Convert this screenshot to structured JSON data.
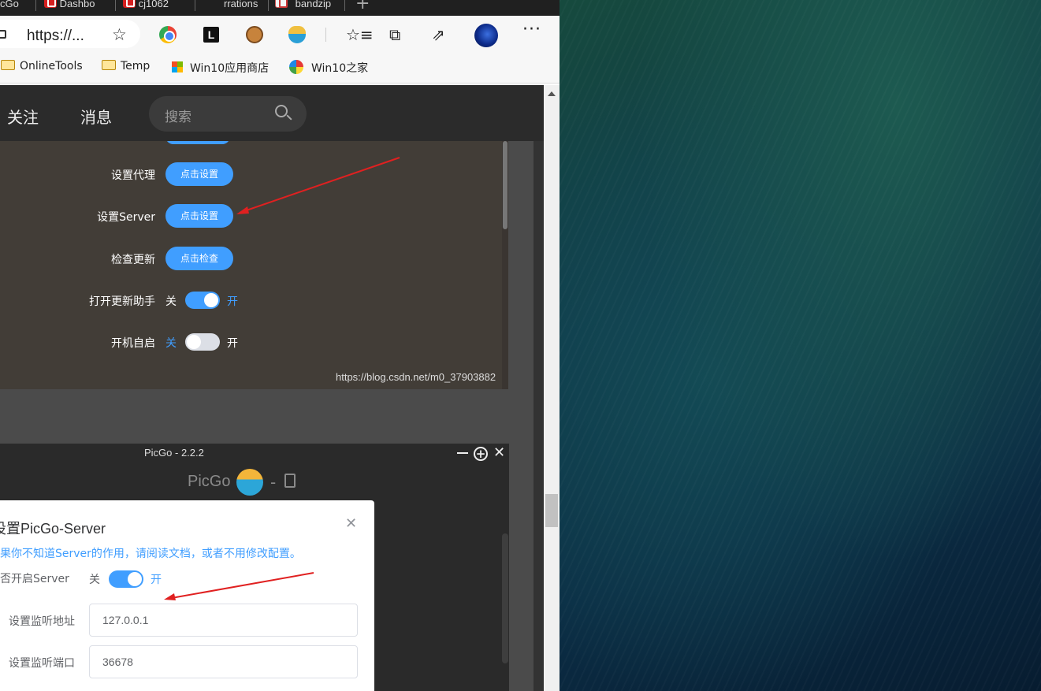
{
  "browser": {
    "tabs": [
      {
        "label": "cGo"
      },
      {
        "label": "Dashbo"
      },
      {
        "label": "cj1062"
      },
      {
        "label": "rrations"
      },
      {
        "label": "bandzip"
      }
    ],
    "url": "https://...",
    "bookmarks": [
      {
        "label": "OnlineTools"
      },
      {
        "label": "Temp"
      },
      {
        "label": "Win10应用商店"
      },
      {
        "label": "Win10之家"
      }
    ]
  },
  "site": {
    "nav": {
      "follow": "关注",
      "messages": "消息"
    },
    "search": {
      "placeholder": "搜索"
    }
  },
  "settings_panel": {
    "proxy": {
      "label": "设置代理",
      "button": "点击设置"
    },
    "server": {
      "label": "设置Server",
      "button": "点击设置"
    },
    "update": {
      "label": "检查更新",
      "button": "点击检查"
    },
    "update_helper": {
      "label": "打开更新助手",
      "off": "关",
      "on": "开",
      "enabled": true
    },
    "autostart": {
      "label": "开机自启",
      "off": "关",
      "on": "开",
      "enabled": false
    },
    "watermark": "https://blog.csdn.net/m0_37903882"
  },
  "picgo_window": {
    "title": "PicGo - 2.2.2",
    "brand": "PicGo",
    "brand_sep": "-",
    "dialog": {
      "title": "设置PicGo-Server",
      "tip": "如果你不知道Server的作用，请阅读文档，或者不用修改配置。",
      "enable_label": "是否开启Server",
      "enable_off": "关",
      "enable_on": "开",
      "enabled": true,
      "host_label": "设置监听地址",
      "host_value": "127.0.0.1",
      "port_label": "设置监听端口",
      "port_value": "36678"
    }
  },
  "colors": {
    "accent": "#409eff",
    "annotation_arrow": "#e02020"
  }
}
